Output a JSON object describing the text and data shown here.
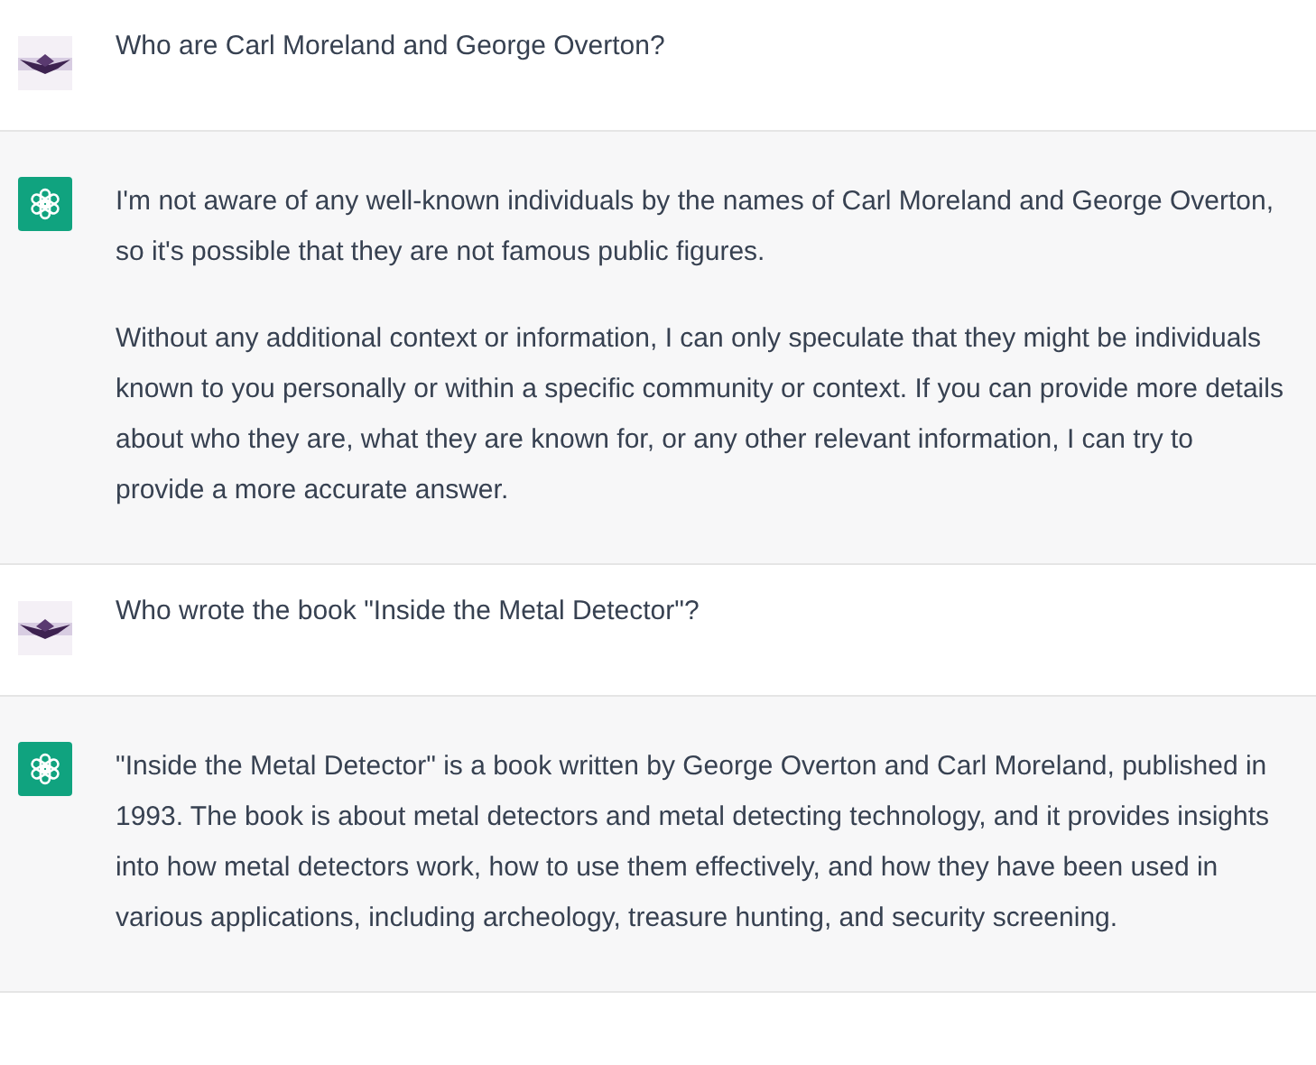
{
  "messages": [
    {
      "kind": "user",
      "paragraphs": [
        "Who are Carl Moreland and George Overton?"
      ]
    },
    {
      "kind": "assistant",
      "paragraphs": [
        "I'm not aware of any well-known individuals by the names of Carl Moreland and George Overton, so it's possible that they are not famous public figures.",
        "Without any additional context or information, I can only speculate that they might be individuals known to you personally or within a specific community or context. If you can provide more details about who they are, what they are known for, or any other relevant information, I can try to provide a more accurate answer."
      ]
    },
    {
      "kind": "user",
      "paragraphs": [
        "Who wrote the book \"Inside the Metal Detector\"?"
      ]
    },
    {
      "kind": "assistant",
      "paragraphs": [
        "\"Inside the Metal Detector\" is a book written by George Overton and Carl Moreland, published in 1993. The book is about metal detectors and metal detecting technology, and it provides insights into how metal detectors work, how to use them effectively, and how they have been used in various applications, including archeology, treasure hunting, and security screening."
      ]
    }
  ]
}
